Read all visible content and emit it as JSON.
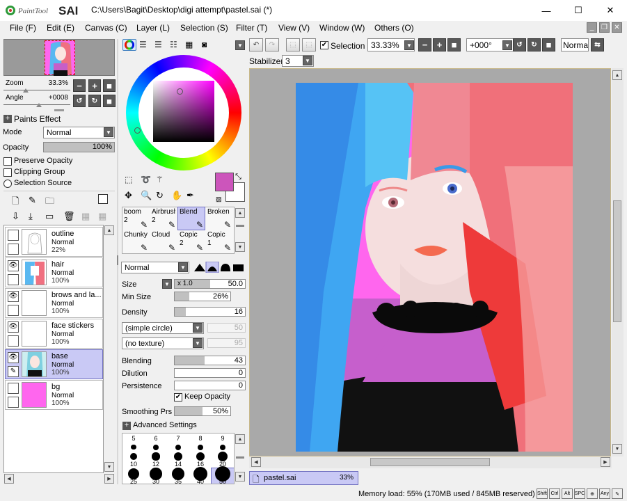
{
  "app": {
    "logo_text": "PaintTool SAI",
    "title": "C:\\Users\\Bagit\\Desktop\\digi attempt\\pastel.sai (*)"
  },
  "window_controls": {
    "minimize": "—",
    "maximize": "☐",
    "close": "✕"
  },
  "menu": [
    "File (F)",
    "Edit (E)",
    "Canvas (C)",
    "Layer (L)",
    "Selection (S)",
    "Filter (T)",
    "View (V)",
    "Window (W)",
    "Others (O)"
  ],
  "navigator": {
    "zoom_label": "Zoom",
    "zoom_value": "33.3%",
    "angle_label": "Angle",
    "angle_value": "+0008"
  },
  "paint_effect": {
    "header": "Paints Effect",
    "mode_label": "Mode",
    "mode_value": "Normal",
    "opacity_label": "Opacity",
    "opacity_value": "100%",
    "opacity_fraction": 1.0,
    "preserve_opacity": "Preserve Opacity",
    "clipping_group": "Clipping Group",
    "selection_source": "Selection Source"
  },
  "layers": [
    {
      "name": "outline",
      "mode": "Normal",
      "opacity": "22%",
      "visible": false,
      "selected": false,
      "thumb": "sketch"
    },
    {
      "name": "hair",
      "mode": "Normal",
      "opacity": "100%",
      "visible": true,
      "selected": false,
      "thumb": "hair"
    },
    {
      "name": "brows and la...",
      "mode": "Normal",
      "opacity": "100%",
      "visible": true,
      "selected": false,
      "thumb": "blank"
    },
    {
      "name": "face stickers",
      "mode": "Normal",
      "opacity": "100%",
      "visible": true,
      "selected": false,
      "thumb": "blank"
    },
    {
      "name": "base",
      "mode": "Normal",
      "opacity": "100%",
      "visible": true,
      "selected": true,
      "thumb": "base"
    },
    {
      "name": "bg",
      "mode": "Normal",
      "opacity": "100%",
      "visible": false,
      "selected": false,
      "thumb": "pink"
    }
  ],
  "colors": {
    "primary": "#cc55bb",
    "secondary": "#ffffff",
    "canvas_bg": "#ff66ee",
    "selected_layer": "#c9c9f5"
  },
  "brushes": [
    {
      "name": "boom",
      "size": "2"
    },
    {
      "name": "Airbrush",
      "size": "2"
    },
    {
      "name": "Blend",
      "size": ""
    },
    {
      "name": "Broken Chalk",
      "size": ""
    },
    {
      "name": "Chunky",
      "size": ""
    },
    {
      "name": "Cloud",
      "size": ""
    },
    {
      "name": "Copic",
      "size": "2"
    },
    {
      "name": "Copic",
      "size": "1"
    }
  ],
  "brush_settings": {
    "blend_mode": "Normal",
    "size_label": "Size",
    "size_mult": "x 1.0",
    "size_value": "50.0",
    "size_fraction": 0.5,
    "min_size_label": "Min Size",
    "min_size_value": "26%",
    "min_size_fraction": 0.26,
    "density_label": "Density",
    "density_value": "16",
    "density_fraction": 0.16,
    "shape": "(simple circle)",
    "shape_value": "50",
    "texture": "(no texture)",
    "texture_value": "95",
    "blending_label": "Blending",
    "blending_value": "43",
    "blending_fraction": 0.43,
    "dilution_label": "Dilution",
    "dilution_value": "0",
    "persistence_label": "Persistence",
    "persistence_value": "0",
    "keep_opacity": "Keep Opacity",
    "smoothing_label": "Smoothing Prs",
    "smoothing_value": "50%",
    "smoothing_fraction": 0.5,
    "advanced": "Advanced Settings"
  },
  "brush_sizes": [
    "5",
    "6",
    "7",
    "8",
    "9",
    "10",
    "12",
    "14",
    "16",
    "20",
    "25",
    "30",
    "35",
    "40",
    "50"
  ],
  "toolbar": {
    "selection_label": "Selection",
    "zoom_value": "33.33%",
    "angle_value": "+000°",
    "blend_value": "Normal",
    "stabilizer_label": "Stabilizer",
    "stabilizer_value": "3"
  },
  "canvas_tab": {
    "name": "pastel.sai",
    "zoom": "33%"
  },
  "status": {
    "memory": "Memory load: 55% (170MB used / 845MB reserved)",
    "keys": [
      "Shift",
      "Ctrl",
      "Alt",
      "SPC",
      "⊕",
      "Any",
      "✎"
    ]
  }
}
